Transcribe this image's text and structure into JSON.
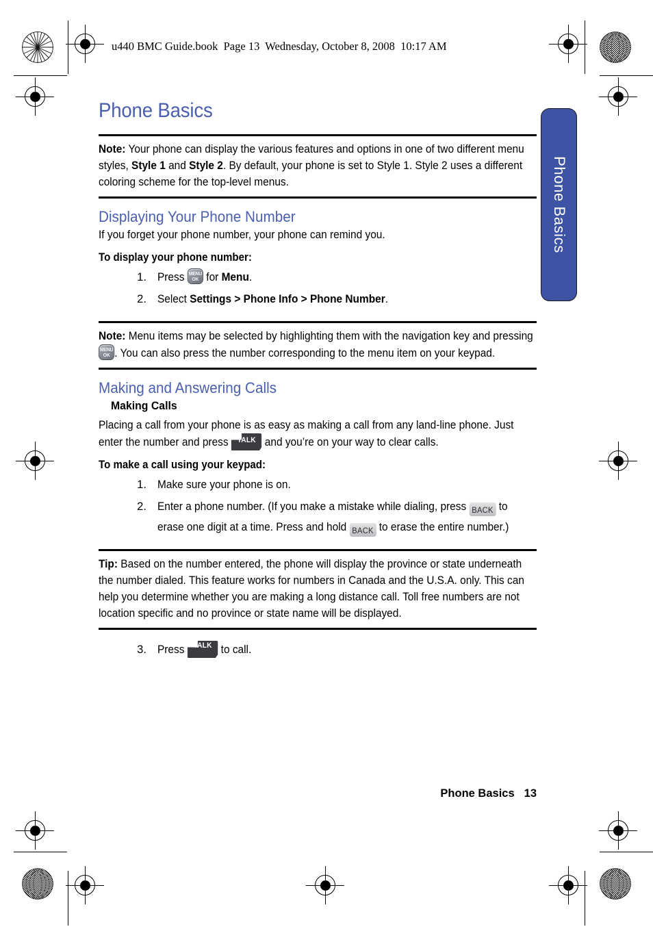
{
  "book_header": "u440 BMC Guide.book  Page 13  Wednesday, October 8, 2008  10:17 AM",
  "side_tab": {
    "label": "Phone Basics"
  },
  "page": {
    "title": "Phone Basics",
    "footer_chapter": "Phone Basics",
    "footer_page_number": "13"
  },
  "colors": {
    "heading_blue": "#4a5fb0",
    "tab_blue": "#3d53a3",
    "rule_black": "#000000",
    "key_dark": "#3c3c40",
    "key_light": "#cfcfd2"
  },
  "note_1": {
    "label": "Note:",
    "text_a": " Your phone can display the various features and options in one of two different menu styles, ",
    "bold_a": "Style 1",
    "text_b": " and ",
    "bold_b": "Style 2",
    "text_c": ". By default, your phone is set to Style 1. Style 2 uses a different coloring scheme for the top-level menus."
  },
  "section_display": {
    "heading": "Displaying Your Phone Number",
    "intro": "If you forget your phone number, your phone can remind you.",
    "lead_in": "To display your phone number:",
    "steps": [
      {
        "num": "1.",
        "pre": "Press ",
        "key": "menu-ok-key",
        "mid": " for ",
        "bold": "Menu",
        "post": "."
      },
      {
        "num": "2.",
        "pre": "Select ",
        "bold": "Settings > Phone Info > Phone Number",
        "post": "."
      }
    ]
  },
  "note_2": {
    "label": "Note:",
    "text_a": " Menu items may be selected by highlighting them with the navigation key and pressing ",
    "key": "menu-ok-key",
    "text_b": ". You can also press the number corresponding to the menu item on your keypad."
  },
  "section_calls": {
    "heading": "Making and Answering Calls",
    "subheading": "Making Calls",
    "para_a": "Placing a call from your phone is as easy as making a call from any land-line phone. Just enter the number and press ",
    "key": "talk-key",
    "para_b": " and you’re on your way to clear calls.",
    "lead_in": "To make a call using your keypad:",
    "step_1": {
      "num": "1.",
      "text": "Make sure your phone is on."
    },
    "step_2": {
      "num": "2.",
      "text_a": "Enter a phone number. (If you make a mistake while dialing, press ",
      "key_a": "back-key",
      "text_b": " to erase one digit at a time. Press and hold ",
      "key_b": "back-key",
      "text_c": " to erase the entire number.)"
    },
    "step_3": {
      "num": "3.",
      "pre": "Press ",
      "key": "talk-key",
      "post": " to call."
    }
  },
  "tip": {
    "label": "Tip:",
    "text": " Based on the number entered, the phone will display the province or state underneath the number dialed. This feature works for numbers in Canada and the U.S.A. only. This can help you determine whether you are making a long distance call. Toll free numbers are not location specific and no province or state name will be displayed."
  },
  "keys": {
    "menu_ok": {
      "line1": "MENU",
      "line2": "OK"
    },
    "talk": {
      "label": "TALK"
    },
    "back": {
      "label": "BACK"
    }
  }
}
